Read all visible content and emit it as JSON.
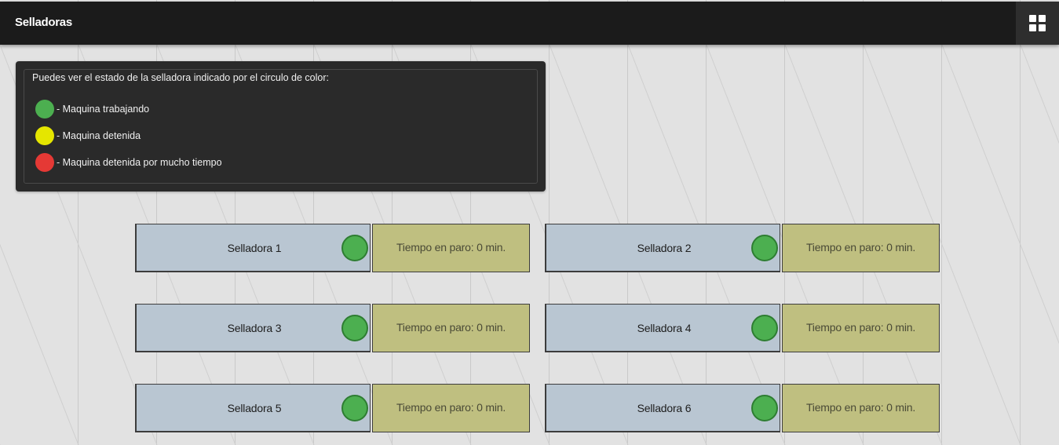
{
  "header": {
    "title": "Selladoras",
    "grid_button_icon": "grid-icon"
  },
  "legend": {
    "intro": "Puedes ver el estado de la selladora indicado por el circulo de color:",
    "items": [
      {
        "color": "#4caf50",
        "label": "- Maquina trabajando"
      },
      {
        "color": "#e5e600",
        "label": "- Maquina detenida"
      },
      {
        "color": "#e53935",
        "label": "- Maquina detenida por mucho tiempo"
      }
    ]
  },
  "machines": [
    {
      "name": "Selladora 1",
      "time": "Tiempo en paro: 0 min.",
      "status_color": "#4caf50"
    },
    {
      "name": "Selladora 2",
      "time": "Tiempo en paro: 0 min.",
      "status_color": "#4caf50"
    },
    {
      "name": "Selladora 3",
      "time": "Tiempo en paro: 0 min.",
      "status_color": "#4caf50"
    },
    {
      "name": "Selladora 4",
      "time": "Tiempo en paro: 0 min.",
      "status_color": "#4caf50"
    },
    {
      "name": "Selladora 5",
      "time": "Tiempo en paro: 0 min.",
      "status_color": "#4caf50"
    },
    {
      "name": "Selladora 6",
      "time": "Tiempo en paro: 0 min.",
      "status_color": "#4caf50"
    }
  ]
}
